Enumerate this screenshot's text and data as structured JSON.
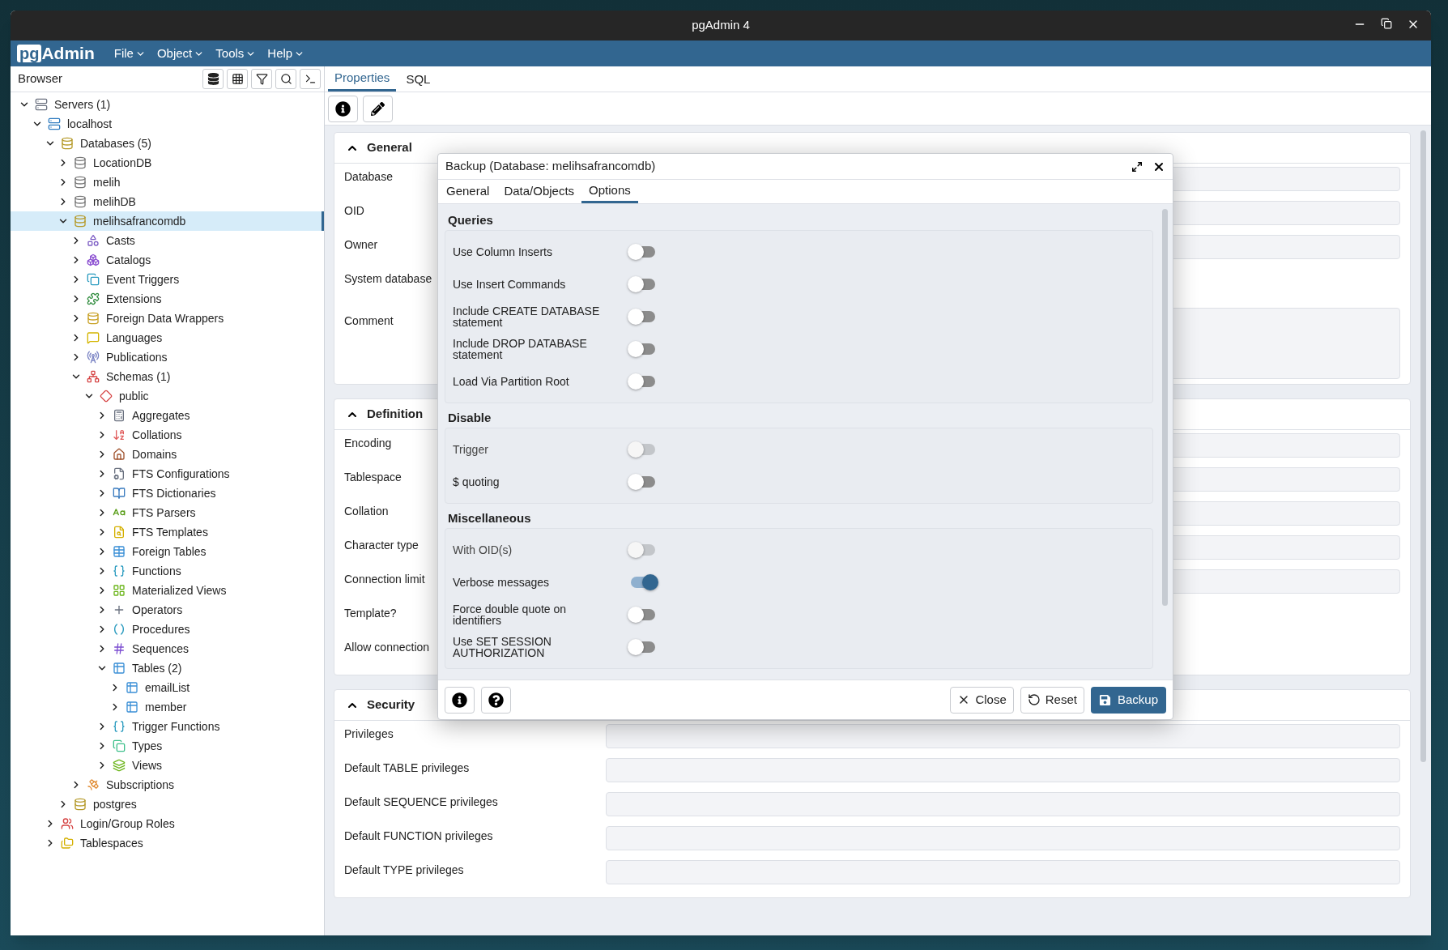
{
  "window": {
    "title": "pgAdmin 4"
  },
  "logo": {
    "part_1": "pg",
    "part_2": "Admin"
  },
  "menu": [
    "File",
    "Object",
    "Tools",
    "Help"
  ],
  "browser": {
    "title": "Browser",
    "tree": [
      {
        "label": "Servers (1)",
        "kind": "server-group",
        "expanded": true,
        "selected": false,
        "children": [
          {
            "label": "localhost",
            "kind": "server",
            "expanded": true,
            "selected": false,
            "children": [
              {
                "label": "Databases (5)",
                "kind": "databases",
                "expanded": true,
                "selected": false,
                "children": [
                  {
                    "label": "LocationDB",
                    "kind": "database-off",
                    "expanded": false,
                    "selected": false
                  },
                  {
                    "label": "melih",
                    "kind": "database-off",
                    "expanded": false,
                    "selected": false
                  },
                  {
                    "label": "melihDB",
                    "kind": "database-off",
                    "expanded": false,
                    "selected": false
                  },
                  {
                    "label": "melihsafrancomdb",
                    "kind": "database",
                    "expanded": true,
                    "selected": true,
                    "children": [
                      {
                        "label": "Casts",
                        "kind": "casts",
                        "expanded": false,
                        "selected": false
                      },
                      {
                        "label": "Catalogs",
                        "kind": "catalogs",
                        "expanded": false,
                        "selected": false
                      },
                      {
                        "label": "Event Triggers",
                        "kind": "event-triggers",
                        "expanded": false,
                        "selected": false
                      },
                      {
                        "label": "Extensions",
                        "kind": "extensions",
                        "expanded": false,
                        "selected": false
                      },
                      {
                        "label": "Foreign Data Wrappers",
                        "kind": "fdw",
                        "expanded": false,
                        "selected": false
                      },
                      {
                        "label": "Languages",
                        "kind": "languages",
                        "expanded": false,
                        "selected": false
                      },
                      {
                        "label": "Publications",
                        "kind": "publications",
                        "expanded": false,
                        "selected": false
                      },
                      {
                        "label": "Schemas (1)",
                        "kind": "schemas",
                        "expanded": true,
                        "selected": false,
                        "children": [
                          {
                            "label": "public",
                            "kind": "schema",
                            "expanded": true,
                            "selected": false,
                            "children": [
                              {
                                "label": "Aggregates",
                                "kind": "aggregates",
                                "expanded": false,
                                "selected": false
                              },
                              {
                                "label": "Collations",
                                "kind": "collations",
                                "expanded": false,
                                "selected": false
                              },
                              {
                                "label": "Domains",
                                "kind": "domains",
                                "expanded": false,
                                "selected": false
                              },
                              {
                                "label": "FTS Configurations",
                                "kind": "fts-config",
                                "expanded": false,
                                "selected": false
                              },
                              {
                                "label": "FTS Dictionaries",
                                "kind": "fts-dict",
                                "expanded": false,
                                "selected": false
                              },
                              {
                                "label": "FTS Parsers",
                                "kind": "fts-parsers",
                                "expanded": false,
                                "selected": false
                              },
                              {
                                "label": "FTS Templates",
                                "kind": "fts-templates",
                                "expanded": false,
                                "selected": false
                              },
                              {
                                "label": "Foreign Tables",
                                "kind": "foreign-tables",
                                "expanded": false,
                                "selected": false
                              },
                              {
                                "label": "Functions",
                                "kind": "functions",
                                "expanded": false,
                                "selected": false
                              },
                              {
                                "label": "Materialized Views",
                                "kind": "mviews",
                                "expanded": false,
                                "selected": false
                              },
                              {
                                "label": "Operators",
                                "kind": "operators",
                                "expanded": false,
                                "selected": false
                              },
                              {
                                "label": "Procedures",
                                "kind": "procedures",
                                "expanded": false,
                                "selected": false
                              },
                              {
                                "label": "Sequences",
                                "kind": "sequences",
                                "expanded": false,
                                "selected": false
                              },
                              {
                                "label": "Tables (2)",
                                "kind": "tables",
                                "expanded": true,
                                "selected": false,
                                "children": [
                                  {
                                    "label": "emailList",
                                    "kind": "table",
                                    "expanded": false,
                                    "selected": false
                                  },
                                  {
                                    "label": "member",
                                    "kind": "table",
                                    "expanded": false,
                                    "selected": false
                                  }
                                ]
                              },
                              {
                                "label": "Trigger Functions",
                                "kind": "trigger-functions",
                                "expanded": false,
                                "selected": false
                              },
                              {
                                "label": "Types",
                                "kind": "types",
                                "expanded": false,
                                "selected": false
                              },
                              {
                                "label": "Views",
                                "kind": "views",
                                "expanded": false,
                                "selected": false
                              }
                            ]
                          }
                        ]
                      },
                      {
                        "label": "Subscriptions",
                        "kind": "subscriptions",
                        "expanded": false,
                        "selected": false
                      }
                    ]
                  },
                  {
                    "label": "postgres",
                    "kind": "database",
                    "expanded": false,
                    "selected": false
                  }
                ]
              },
              {
                "label": "Login/Group Roles",
                "kind": "roles",
                "expanded": false,
                "selected": false
              },
              {
                "label": "Tablespaces",
                "kind": "tablespaces",
                "expanded": false,
                "selected": false
              }
            ]
          }
        ]
      }
    ]
  },
  "tabs": [
    {
      "label": "Properties",
      "selected": true
    },
    {
      "label": "SQL",
      "selected": false
    }
  ],
  "properties": {
    "sections": [
      {
        "title": "General",
        "expanded": true,
        "rows": [
          {
            "label": "Database",
            "kind": "field"
          },
          {
            "label": "OID",
            "kind": "field"
          },
          {
            "label": "Owner",
            "kind": "field"
          },
          {
            "label": "System database",
            "kind": "none"
          },
          {
            "label": "Comment",
            "kind": "textarea"
          }
        ]
      },
      {
        "title": "Definition",
        "expanded": true,
        "rows": [
          {
            "label": "Encoding",
            "kind": "field"
          },
          {
            "label": "Tablespace",
            "kind": "field"
          },
          {
            "label": "Collation",
            "kind": "field"
          },
          {
            "label": "Character type",
            "kind": "field"
          },
          {
            "label": "Connection limit",
            "kind": "field"
          },
          {
            "label": "Template?",
            "kind": "none"
          },
          {
            "label": "Allow connection",
            "kind": "none"
          }
        ]
      },
      {
        "title": "Security",
        "expanded": true,
        "rows": [
          {
            "label": "Privileges",
            "kind": "field"
          },
          {
            "label": "Default TABLE privileges",
            "kind": "field"
          },
          {
            "label": "Default SEQUENCE privileges",
            "kind": "field"
          },
          {
            "label": "Default FUNCTION privileges",
            "kind": "field"
          },
          {
            "label": "Default TYPE privileges",
            "kind": "field"
          }
        ]
      }
    ]
  },
  "dialog": {
    "title": "Backup (Database: melihsafrancomdb)",
    "tabs": [
      {
        "label": "General",
        "selected": false
      },
      {
        "label": "Data/Objects",
        "selected": false
      },
      {
        "label": "Options",
        "selected": true
      }
    ],
    "groups": [
      {
        "title": "Queries",
        "options": [
          {
            "label": "Use Column Inserts",
            "on": false,
            "disabled": false
          },
          {
            "label": "Use Insert Commands",
            "on": false,
            "disabled": false
          },
          {
            "label": "Include CREATE DATABASE statement",
            "on": false,
            "disabled": false
          },
          {
            "label": "Include DROP DATABASE statement",
            "on": false,
            "disabled": false
          },
          {
            "label": "Load Via Partition Root",
            "on": false,
            "disabled": false
          }
        ]
      },
      {
        "title": "Disable",
        "options": [
          {
            "label": "Trigger",
            "on": false,
            "disabled": true
          },
          {
            "label": "$ quoting",
            "on": false,
            "disabled": false
          }
        ]
      },
      {
        "title": "Miscellaneous",
        "options": [
          {
            "label": "With OID(s)",
            "on": false,
            "disabled": true
          },
          {
            "label": "Verbose messages",
            "on": true,
            "disabled": false
          },
          {
            "label": "Force double quote on identifiers",
            "on": false,
            "disabled": false
          },
          {
            "label": "Use SET SESSION AUTHORIZATION",
            "on": false,
            "disabled": false
          }
        ]
      }
    ],
    "buttons": [
      {
        "label": "Close",
        "kind": "close"
      },
      {
        "label": "Reset",
        "kind": "reset"
      },
      {
        "label": "Backup",
        "kind": "primary"
      }
    ]
  }
}
